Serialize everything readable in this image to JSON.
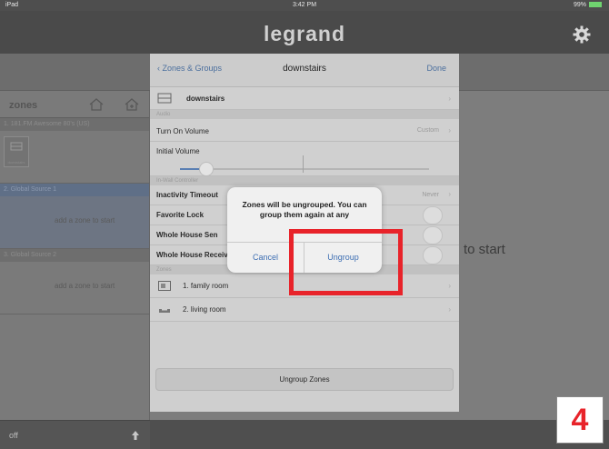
{
  "status": {
    "device": "iPad",
    "time": "3:42 PM",
    "battery": "99%"
  },
  "header": {
    "brand": "legrand"
  },
  "zones_panel": {
    "title": "zones",
    "sources": [
      {
        "header": "1. 181.FM Awesome 80's (US)",
        "add_text": "",
        "thumb_caption": "downstairs"
      },
      {
        "header": "2. Global Source 1",
        "add_text": "add a zone to start"
      },
      {
        "header": "3. Global Source 2",
        "add_text": "add a zone to start"
      }
    ],
    "footer_status": "off"
  },
  "main": {
    "hint": "to start"
  },
  "sheet": {
    "back_label": "Zones & Groups",
    "title": "downstairs",
    "done_label": "Done",
    "group_name": "downstairs",
    "sections": {
      "audio": "Audio",
      "in_wall": "In-Wall Controller",
      "zones": "Zones"
    },
    "turn_on_volume": {
      "label": "Turn On Volume",
      "value": "Custom"
    },
    "initial_volume": {
      "label": "Initial Volume"
    },
    "inactivity_timeout": {
      "label": "Inactivity Timeout",
      "value": "Never"
    },
    "favorite_lock": {
      "label": "Favorite Lock"
    },
    "whole_house_send": {
      "label": "Whole House Sen"
    },
    "whole_house_receive": {
      "label": "Whole House Receive Disabled"
    },
    "zones": [
      {
        "label": "1. family room",
        "icon": "tv-icon"
      },
      {
        "label": "2. living room",
        "icon": "sofa-icon"
      }
    ],
    "ungroup_zones_label": "Ungroup Zones"
  },
  "alert": {
    "message": "Zones will be ungrouped.  You can group them again at any",
    "cancel_label": "Cancel",
    "ok_label": "Ungroup"
  },
  "step_number": "4",
  "colors": {
    "accent_blue": "#3e6fb3",
    "highlight_red": "#e8232a"
  }
}
